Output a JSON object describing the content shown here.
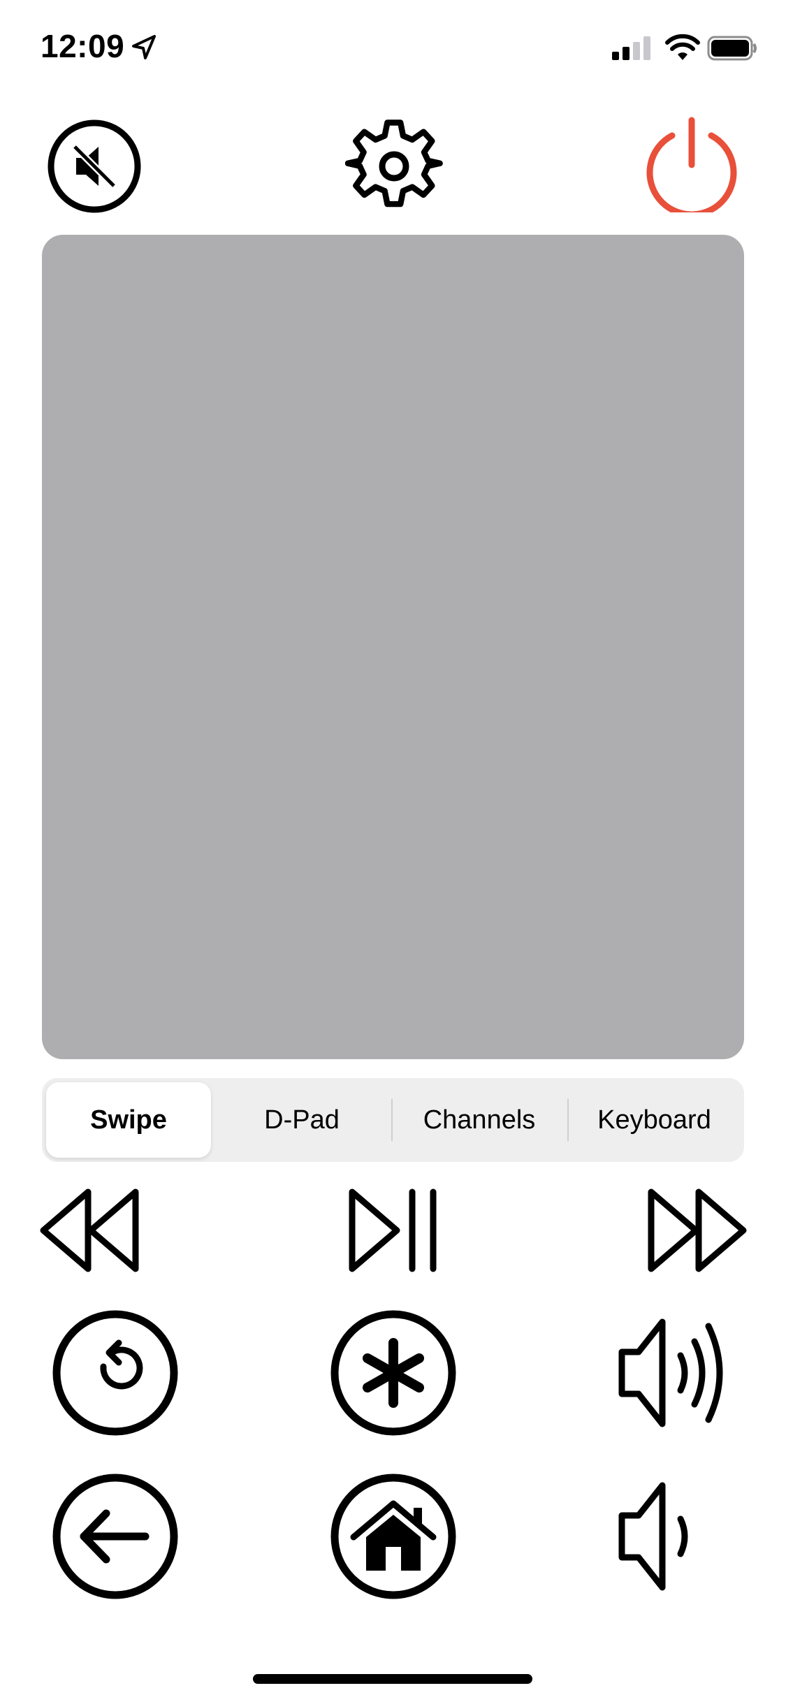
{
  "status_bar": {
    "time": "12:09",
    "icons": [
      "location-arrow-icon",
      "cellular-signal-icon",
      "wifi-icon",
      "battery-icon"
    ]
  },
  "top_controls": {
    "mute_icon": "speaker-muted-icon",
    "settings_icon": "gear-icon",
    "power_icon": "power-icon",
    "power_color": "#e8503a"
  },
  "swipe_pad": {
    "background": "#aeaeb0"
  },
  "segments": {
    "selected": "Swipe",
    "items": [
      {
        "label": "Swipe"
      },
      {
        "label": "D-Pad"
      },
      {
        "label": "Channels"
      },
      {
        "label": "Keyboard"
      }
    ]
  },
  "controls": {
    "row1": [
      "rewind-icon",
      "play-pause-icon",
      "fast-forward-icon"
    ],
    "row2": [
      "replay-icon",
      "asterisk-icon",
      "volume-up-icon"
    ],
    "row3": [
      "back-arrow-icon",
      "home-icon",
      "volume-down-icon"
    ]
  }
}
